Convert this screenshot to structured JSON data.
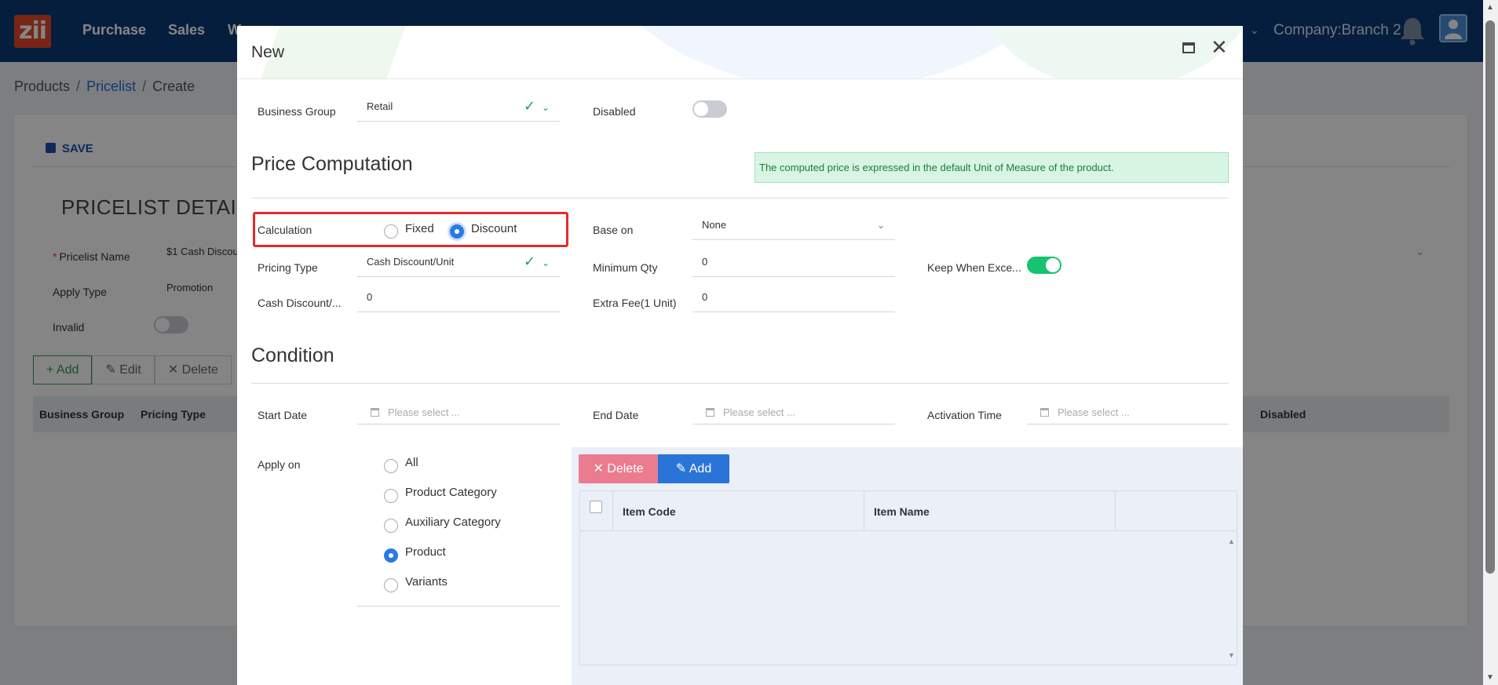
{
  "app": {
    "logo_text": "zii",
    "nav": [
      "Purchase",
      "Sales",
      "W"
    ],
    "company": "Company:Branch 2"
  },
  "breadcrumb": {
    "items": [
      "Products",
      "Pricelist",
      "Create"
    ]
  },
  "background": {
    "save_label": "SAVE",
    "section_title": "PRICELIST DETAIL",
    "pricelist_name_label": "Pricelist Name",
    "pricelist_name_value": "$1 Cash Discou",
    "apply_type_label": "Apply Type",
    "apply_type_value": "Promotion",
    "invalid_label": "Invalid",
    "buttons": {
      "add": "Add",
      "edit": "Edit",
      "delete": "Delete"
    },
    "table_headers": {
      "business_group": "Business Group",
      "pricing_type": "Pricing Type",
      "disabled": "Disabled"
    }
  },
  "modal": {
    "title": "New",
    "business_group": {
      "label": "Business Group",
      "value": "Retail"
    },
    "disabled": {
      "label": "Disabled",
      "value": false
    },
    "price_computation": {
      "title": "Price Computation",
      "info": "The computed price is expressed in the default Unit of Measure of the product.",
      "calculation": {
        "label": "Calculation",
        "options": [
          "Fixed",
          "Discount"
        ],
        "selected": "Discount"
      },
      "base_on": {
        "label": "Base on",
        "value": "None"
      },
      "pricing_type": {
        "label": "Pricing Type",
        "value": "Cash Discount/Unit"
      },
      "minimum_qty": {
        "label": "Minimum Qty",
        "value": "0"
      },
      "keep_when_exceed": {
        "label": "Keep When Exce...",
        "value": true
      },
      "cash_discount": {
        "label": "Cash Discount/...",
        "value": "0"
      },
      "extra_fee": {
        "label": "Extra Fee(1 Unit)",
        "value": "0"
      }
    },
    "condition": {
      "title": "Condition",
      "start_date": {
        "label": "Start Date",
        "placeholder": "Please select ..."
      },
      "end_date": {
        "label": "End Date",
        "placeholder": "Please select ..."
      },
      "activation_time": {
        "label": "Activation Time",
        "placeholder": "Please select ..."
      },
      "apply_on": {
        "label": "Apply on",
        "options": [
          "All",
          "Product Category",
          "Auxiliary Category",
          "Product",
          "Variants"
        ],
        "selected": "Product"
      },
      "grid": {
        "delete_label": "Delete",
        "add_label": "Add",
        "columns": [
          "Item Code",
          "Item Name"
        ],
        "rows": []
      }
    }
  }
}
